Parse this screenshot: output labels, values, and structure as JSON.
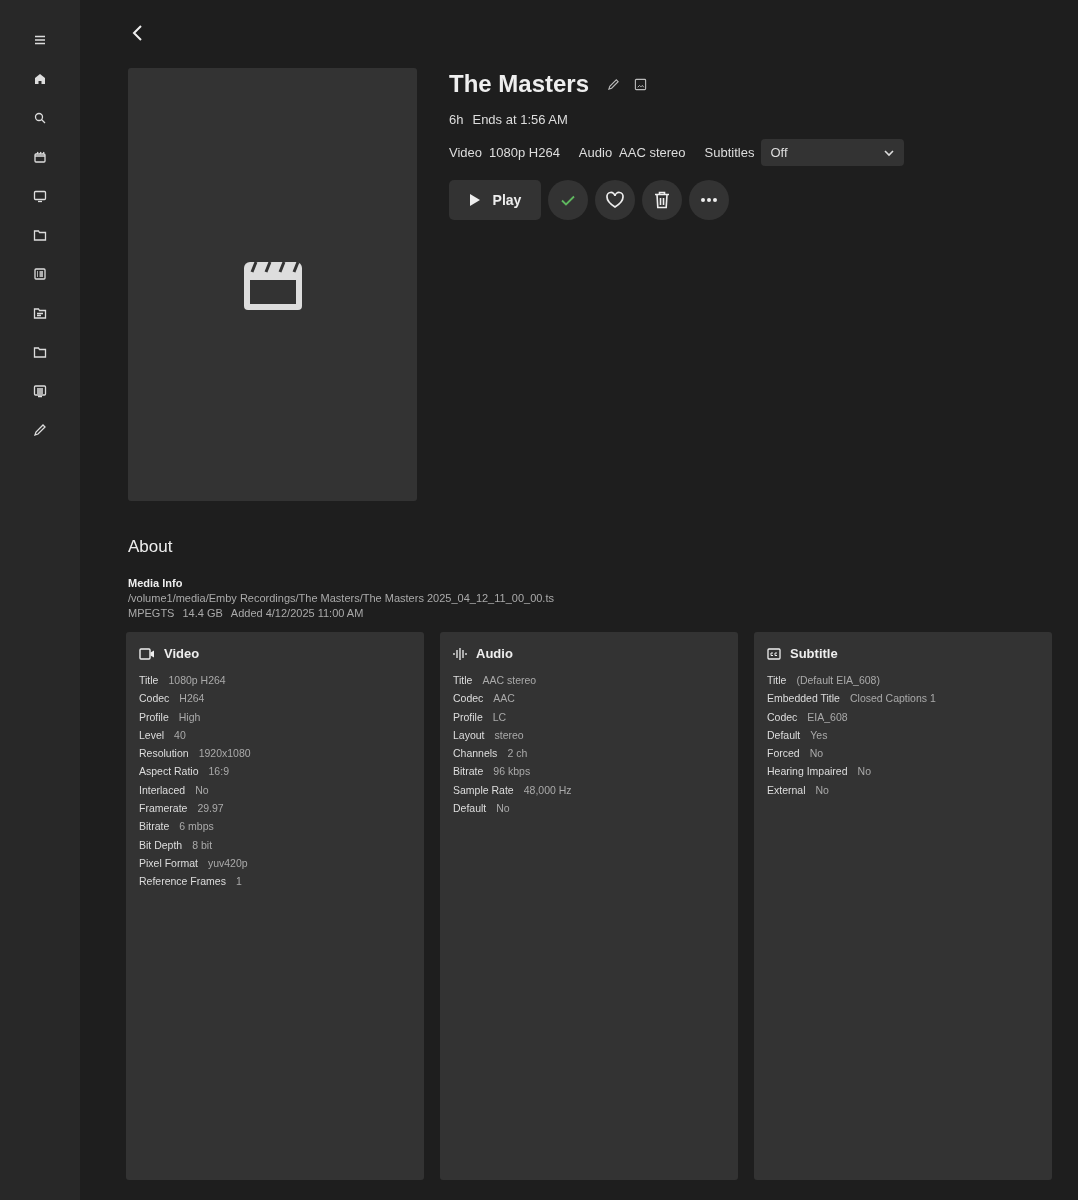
{
  "sidebar": {
    "items": [
      {
        "kind": "menu"
      },
      {
        "kind": "home"
      },
      {
        "kind": "search"
      },
      {
        "kind": "movies"
      },
      {
        "kind": "tv"
      },
      {
        "kind": "folder"
      },
      {
        "kind": "list"
      },
      {
        "kind": "folder-doc"
      },
      {
        "kind": "folder"
      },
      {
        "kind": "guide"
      },
      {
        "kind": "edit"
      }
    ]
  },
  "item": {
    "title": "The Masters",
    "runtime": "6h",
    "ends": "Ends at 1:56 AM",
    "streams": [
      {
        "label": "Video",
        "value": "1080p H264"
      },
      {
        "label": "Audio",
        "value": "AAC stereo"
      }
    ],
    "subtitles": {
      "label": "Subtitles",
      "value": "Off"
    },
    "play_label": "Play",
    "played": true,
    "favorite": false
  },
  "about": {
    "heading": "About",
    "media_info": "Media Info",
    "path": "/volume1/media/Emby Recordings/The Masters/The Masters 2025_04_12_11_00_00.ts",
    "details": [
      "MPEGTS",
      "14.4 GB",
      "Added 4/12/2025 11:00 AM"
    ],
    "cards": [
      {
        "kind": "video",
        "title": "Video",
        "rows": [
          [
            "Title",
            "1080p H264"
          ],
          [
            "Codec",
            "H264"
          ],
          [
            "Profile",
            "High"
          ],
          [
            "Level",
            "40"
          ],
          [
            "Resolution",
            "1920x1080"
          ],
          [
            "Aspect Ratio",
            "16:9"
          ],
          [
            "Interlaced",
            "No"
          ],
          [
            "Framerate",
            "29.97"
          ],
          [
            "Bitrate",
            "6 mbps"
          ],
          [
            "Bit Depth",
            "8 bit"
          ],
          [
            "Pixel Format",
            "yuv420p"
          ],
          [
            "Reference Frames",
            "1"
          ]
        ]
      },
      {
        "kind": "audio",
        "title": "Audio",
        "rows": [
          [
            "Title",
            "AAC stereo"
          ],
          [
            "Codec",
            "AAC"
          ],
          [
            "Profile",
            "LC"
          ],
          [
            "Layout",
            "stereo"
          ],
          [
            "Channels",
            "2 ch"
          ],
          [
            "Bitrate",
            "96 kbps"
          ],
          [
            "Sample Rate",
            "48,000 Hz"
          ],
          [
            "Default",
            "No"
          ]
        ]
      },
      {
        "kind": "subtitle",
        "title": "Subtitle",
        "rows": [
          [
            "Title",
            "(Default EIA_608)"
          ],
          [
            "Embedded Title",
            "Closed Captions 1"
          ],
          [
            "Codec",
            "EIA_608"
          ],
          [
            "Default",
            "Yes"
          ],
          [
            "Forced",
            "No"
          ],
          [
            "Hearing Impaired",
            "No"
          ],
          [
            "External",
            "No"
          ]
        ]
      }
    ]
  }
}
